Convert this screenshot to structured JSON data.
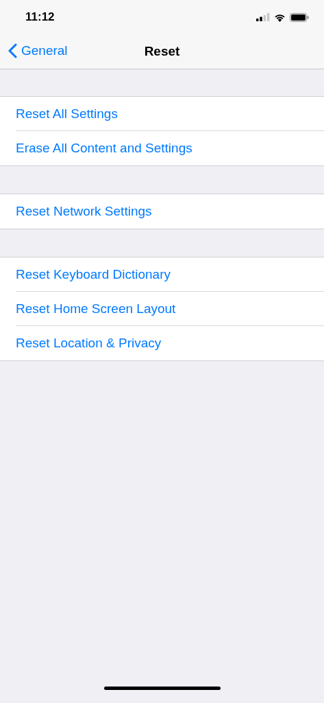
{
  "status_bar": {
    "time": "11:12"
  },
  "nav": {
    "back_label": "General",
    "title": "Reset"
  },
  "groups": [
    {
      "rows": [
        {
          "label": "Reset All Settings"
        },
        {
          "label": "Erase All Content and Settings"
        }
      ]
    },
    {
      "rows": [
        {
          "label": "Reset Network Settings"
        }
      ]
    },
    {
      "rows": [
        {
          "label": "Reset Keyboard Dictionary"
        },
        {
          "label": "Reset Home Screen Layout"
        },
        {
          "label": "Reset Location & Privacy"
        }
      ]
    }
  ]
}
